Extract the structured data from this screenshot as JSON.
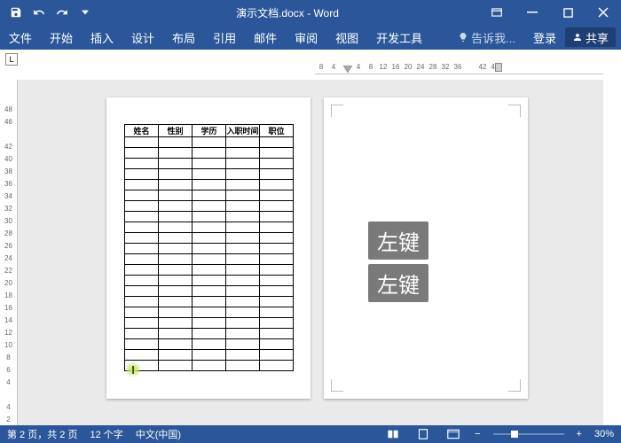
{
  "title": "演示文档.docx - Word",
  "ribbon": {
    "file": "文件",
    "tabs": [
      "开始",
      "插入",
      "设计",
      "布局",
      "引用",
      "邮件",
      "审阅",
      "视图",
      "开发工具"
    ],
    "tellme": "告诉我...",
    "login": "登录",
    "share": "共享"
  },
  "ruler_h": [
    "8",
    "4",
    "",
    "4",
    "8",
    "12",
    "16",
    "20",
    "24",
    "28",
    "32",
    "36",
    "",
    "42",
    "46"
  ],
  "ruler_v": [
    "2",
    "4",
    "",
    "4",
    "6",
    "8",
    "10",
    "12",
    "14",
    "16",
    "18",
    "20",
    "22",
    "24",
    "26",
    "28",
    "30",
    "32",
    "34",
    "36",
    "38",
    "40",
    "42",
    "",
    "46",
    "48"
  ],
  "tabstop": "L",
  "table_headers": [
    "姓名",
    "性别",
    "学历",
    "入职时间",
    "职位"
  ],
  "table_rows": 22,
  "cursor_glyph": "I",
  "overlay": "左键",
  "status": {
    "page": "第 2 页，共 2 页",
    "words": "12 个字",
    "lang": "中文(中国)",
    "zoom": "30%"
  }
}
